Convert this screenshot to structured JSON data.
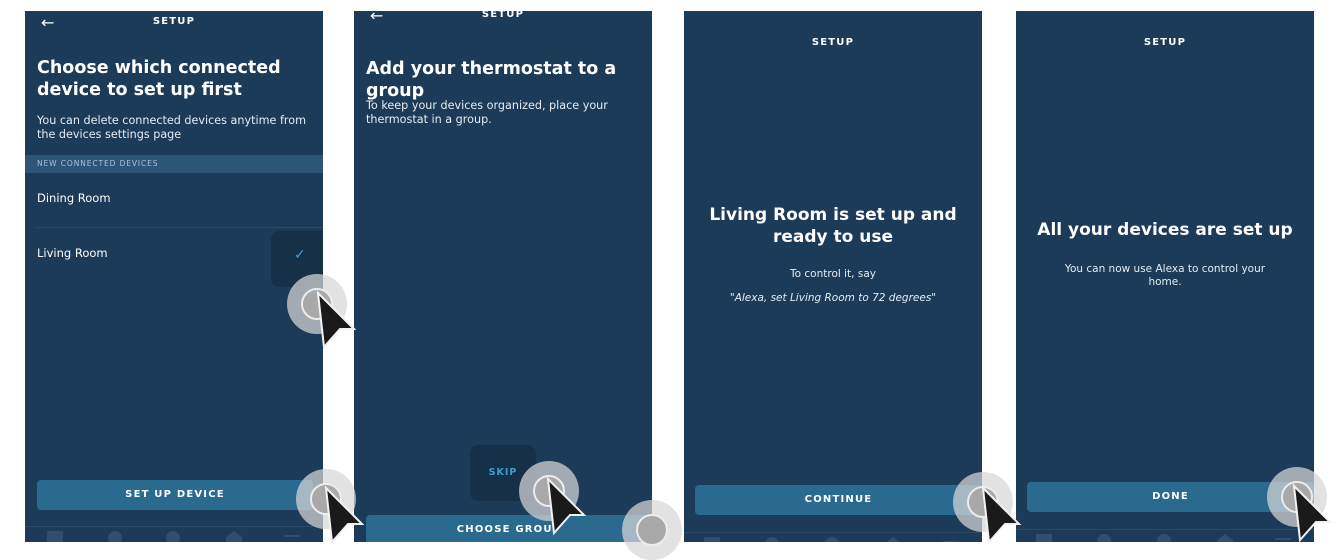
{
  "screens": [
    {
      "header": "SETUP",
      "title": "Choose which connected device to set up first",
      "description": "You can delete connected devices anytime from the devices settings page",
      "section_label": "NEW CONNECTED DEVICES",
      "devices": [
        "Dining Room",
        "Living Room"
      ],
      "selected": "Living Room",
      "button": "SET UP DEVICE"
    },
    {
      "header": "SETUP",
      "title": "Add your thermostat to a group",
      "description": "To keep your devices organized, place your thermostat in a group.",
      "skip": "SKIP",
      "button": "CHOOSE GROUP"
    },
    {
      "header": "SETUP",
      "title": "Living Room is set up and ready to use",
      "subtitle": "To control it, say",
      "quote": "\"Alexa, set Living Room to 72 degrees\"",
      "button": "CONTINUE"
    },
    {
      "header": "SETUP",
      "title": "All your devices are set up",
      "description": "You can now use Alexa to control your home.",
      "button": "DONE"
    }
  ],
  "icons": [
    "back-arrow-icon",
    "checkmark-icon",
    "home-icon",
    "chat-icon",
    "play-icon",
    "devices-icon",
    "menu-icon"
  ],
  "colors": {
    "background": "#1c3b58",
    "button": "#2a6a8f",
    "accent": "#3aa0d6"
  }
}
